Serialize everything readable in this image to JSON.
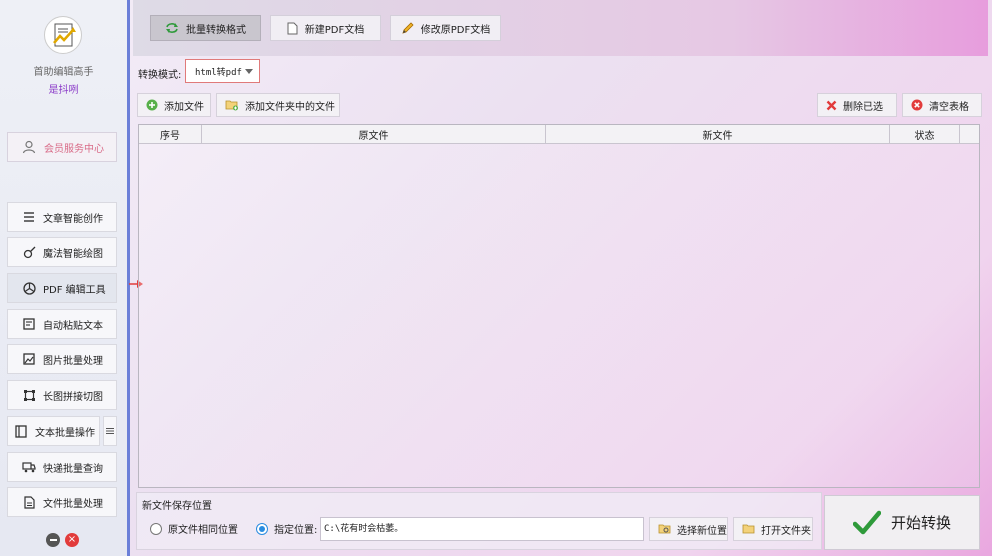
{
  "sidebar": {
    "app_name": "首助编辑高手",
    "user_name": "是抖咧",
    "member_center": "会员服务中心",
    "items": [
      {
        "label": "文章智能创作",
        "icon": "list-icon"
      },
      {
        "label": "魔法智能绘图",
        "icon": "magic-brush-icon"
      },
      {
        "label": "PDF 编辑工具",
        "icon": "pdf-wheel-icon"
      },
      {
        "label": "自动粘贴文本",
        "icon": "paste-icon"
      },
      {
        "label": "图片批量处理",
        "icon": "image-icon"
      },
      {
        "label": "长图拼接切图",
        "icon": "crop-icon"
      },
      {
        "label": "文本批量操作",
        "icon": "book-icon"
      },
      {
        "label": "快递批量查询",
        "icon": "truck-icon"
      },
      {
        "label": "文件批量处理",
        "icon": "file-icon"
      }
    ]
  },
  "tabs": [
    {
      "label": "批量转换格式",
      "icon": "convert-icon"
    },
    {
      "label": "新建PDF文档",
      "icon": "document-icon"
    },
    {
      "label": "修改原PDF文档",
      "icon": "pencil-icon"
    }
  ],
  "mode": {
    "label": "转换模式:",
    "value": "html转pdf"
  },
  "toolbar": {
    "add_file": "添加文件",
    "add_folder": "添加文件夹中的文件",
    "delete_selected": "删除已选",
    "clear_table": "清空表格"
  },
  "table": {
    "columns": [
      "序号",
      "原文件",
      "新文件",
      "状态"
    ],
    "rows": []
  },
  "save": {
    "title": "新文件保存位置",
    "option_same": "原文件相同位置",
    "option_custom": "指定位置:",
    "path": "C:\\花有时会枯萎。",
    "choose_location": "选择新位置",
    "open_folder": "打开文件夹"
  },
  "start_button": "开始转换",
  "colors": {
    "accent": "#6b7fd8",
    "danger": "#e23b3b",
    "success": "#2f9a3b",
    "user": "#8a3ac8"
  }
}
